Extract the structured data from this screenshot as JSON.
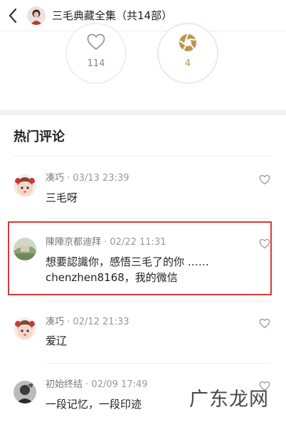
{
  "header": {
    "title": "三毛典藏全集（共14部）"
  },
  "actions": {
    "like_count": "114",
    "reward_count": "4"
  },
  "section": {
    "title": "热门评论"
  },
  "comments": [
    {
      "user": "凑巧",
      "time": "03/13 23:39",
      "lines": [
        "三毛呀"
      ]
    },
    {
      "user": "陳陣京都迪拜",
      "time": "02/22 11:31",
      "lines": [
        "想要認識你，感悟三毛了的你 ……",
        "chenzhen8168，我的微信"
      ]
    },
    {
      "user": "凑巧",
      "time": "02/12 21:33",
      "lines": [
        "爱辽"
      ]
    },
    {
      "user": "初始终结",
      "time": "02/09 17:49",
      "lines": [
        "一段记忆，一段印迹"
      ]
    }
  ],
  "watermark": {
    "text": "广东龙网"
  },
  "colors": {
    "highlight": "#d93838",
    "reward_gold": "#b99650",
    "divider": "#eeeeee"
  }
}
